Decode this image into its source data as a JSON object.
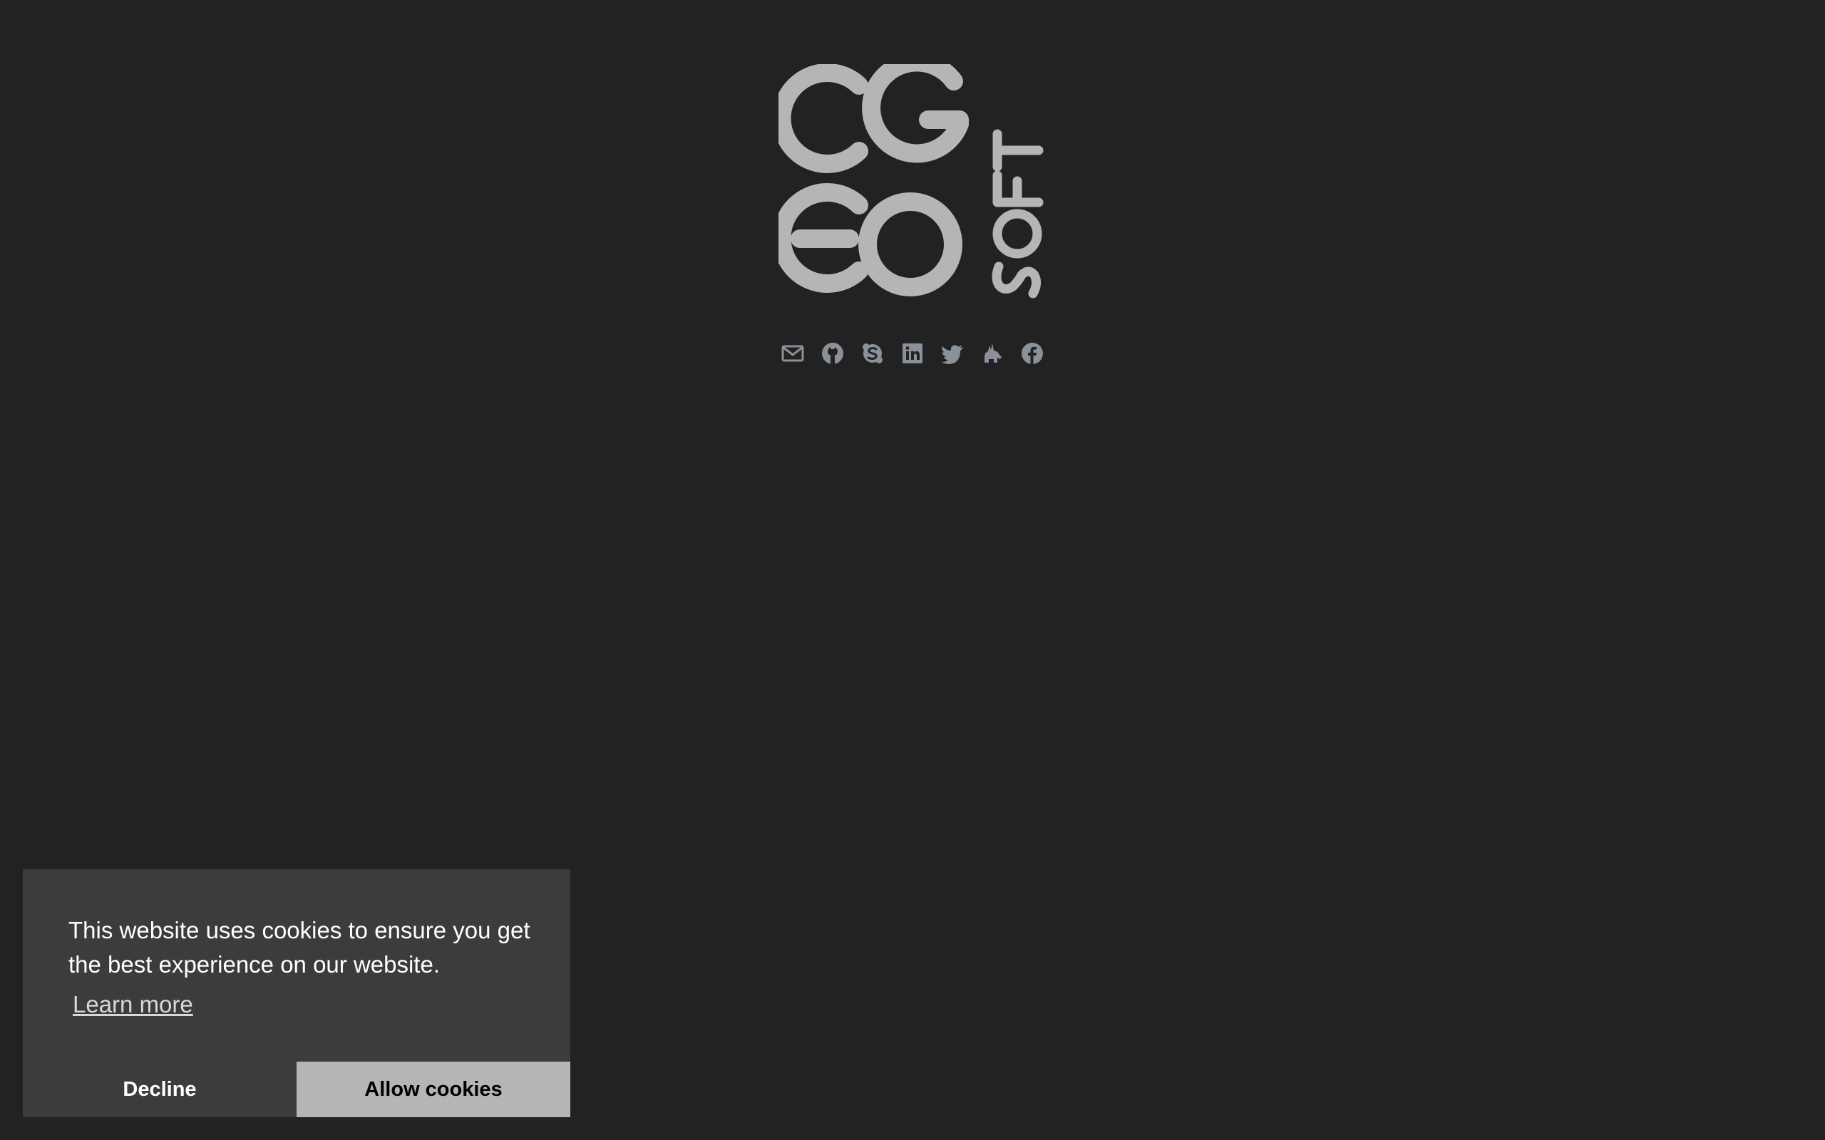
{
  "logo": {
    "text": "CGEO SOFT",
    "color": "#b5b5b5"
  },
  "social": {
    "icon_color": "#8a9199",
    "links": [
      {
        "icon": "mail-icon",
        "label": "Email"
      },
      {
        "icon": "github-icon",
        "label": "GitHub"
      },
      {
        "icon": "skype-icon",
        "label": "Skype"
      },
      {
        "icon": "linkedin-icon",
        "label": "LinkedIn"
      },
      {
        "icon": "twitter-icon",
        "label": "Twitter"
      },
      {
        "icon": "unicorn-icon",
        "label": "Unicorn"
      },
      {
        "icon": "facebook-icon",
        "label": "Facebook"
      }
    ]
  },
  "cookie": {
    "message": "This website uses cookies to ensure you get the best experience on our website.",
    "learn_more": "Learn more",
    "decline": "Decline",
    "allow": "Allow cookies",
    "bg_color": "#3c3c3c",
    "allow_color": "#b5b5b5"
  }
}
